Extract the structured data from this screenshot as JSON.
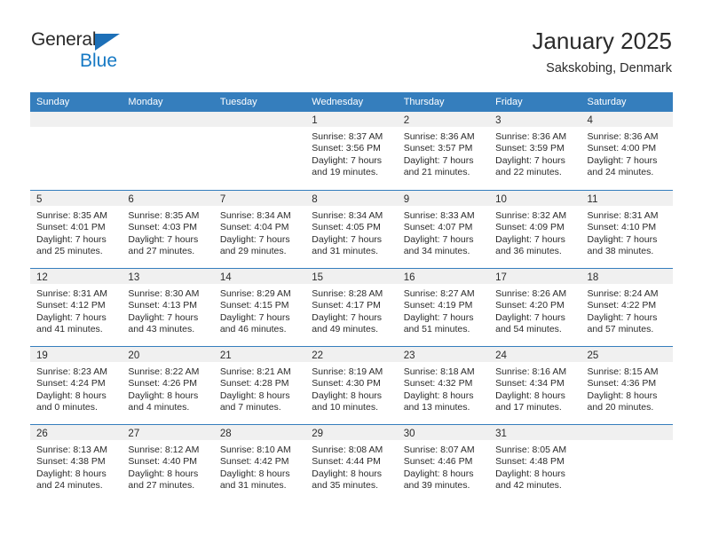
{
  "brand": {
    "name_top": "General",
    "name_bottom": "Blue",
    "accent_color": "#1679c4",
    "triangle_icon": "blue-triangle-icon"
  },
  "header": {
    "title": "January 2025",
    "subtitle": "Sakskobing, Denmark",
    "header_bg_color": "#357ebd",
    "day_band_color": "#f0f0f0"
  },
  "weekdays": [
    "Sunday",
    "Monday",
    "Tuesday",
    "Wednesday",
    "Thursday",
    "Friday",
    "Saturday"
  ],
  "weeks": [
    [
      {
        "day": "",
        "lines": []
      },
      {
        "day": "",
        "lines": []
      },
      {
        "day": "",
        "lines": []
      },
      {
        "day": "1",
        "lines": [
          "Sunrise: 8:37 AM",
          "Sunset: 3:56 PM",
          "Daylight: 7 hours",
          "and 19 minutes."
        ]
      },
      {
        "day": "2",
        "lines": [
          "Sunrise: 8:36 AM",
          "Sunset: 3:57 PM",
          "Daylight: 7 hours",
          "and 21 minutes."
        ]
      },
      {
        "day": "3",
        "lines": [
          "Sunrise: 8:36 AM",
          "Sunset: 3:59 PM",
          "Daylight: 7 hours",
          "and 22 minutes."
        ]
      },
      {
        "day": "4",
        "lines": [
          "Sunrise: 8:36 AM",
          "Sunset: 4:00 PM",
          "Daylight: 7 hours",
          "and 24 minutes."
        ]
      }
    ],
    [
      {
        "day": "5",
        "lines": [
          "Sunrise: 8:35 AM",
          "Sunset: 4:01 PM",
          "Daylight: 7 hours",
          "and 25 minutes."
        ]
      },
      {
        "day": "6",
        "lines": [
          "Sunrise: 8:35 AM",
          "Sunset: 4:03 PM",
          "Daylight: 7 hours",
          "and 27 minutes."
        ]
      },
      {
        "day": "7",
        "lines": [
          "Sunrise: 8:34 AM",
          "Sunset: 4:04 PM",
          "Daylight: 7 hours",
          "and 29 minutes."
        ]
      },
      {
        "day": "8",
        "lines": [
          "Sunrise: 8:34 AM",
          "Sunset: 4:05 PM",
          "Daylight: 7 hours",
          "and 31 minutes."
        ]
      },
      {
        "day": "9",
        "lines": [
          "Sunrise: 8:33 AM",
          "Sunset: 4:07 PM",
          "Daylight: 7 hours",
          "and 34 minutes."
        ]
      },
      {
        "day": "10",
        "lines": [
          "Sunrise: 8:32 AM",
          "Sunset: 4:09 PM",
          "Daylight: 7 hours",
          "and 36 minutes."
        ]
      },
      {
        "day": "11",
        "lines": [
          "Sunrise: 8:31 AM",
          "Sunset: 4:10 PM",
          "Daylight: 7 hours",
          "and 38 minutes."
        ]
      }
    ],
    [
      {
        "day": "12",
        "lines": [
          "Sunrise: 8:31 AM",
          "Sunset: 4:12 PM",
          "Daylight: 7 hours",
          "and 41 minutes."
        ]
      },
      {
        "day": "13",
        "lines": [
          "Sunrise: 8:30 AM",
          "Sunset: 4:13 PM",
          "Daylight: 7 hours",
          "and 43 minutes."
        ]
      },
      {
        "day": "14",
        "lines": [
          "Sunrise: 8:29 AM",
          "Sunset: 4:15 PM",
          "Daylight: 7 hours",
          "and 46 minutes."
        ]
      },
      {
        "day": "15",
        "lines": [
          "Sunrise: 8:28 AM",
          "Sunset: 4:17 PM",
          "Daylight: 7 hours",
          "and 49 minutes."
        ]
      },
      {
        "day": "16",
        "lines": [
          "Sunrise: 8:27 AM",
          "Sunset: 4:19 PM",
          "Daylight: 7 hours",
          "and 51 minutes."
        ]
      },
      {
        "day": "17",
        "lines": [
          "Sunrise: 8:26 AM",
          "Sunset: 4:20 PM",
          "Daylight: 7 hours",
          "and 54 minutes."
        ]
      },
      {
        "day": "18",
        "lines": [
          "Sunrise: 8:24 AM",
          "Sunset: 4:22 PM",
          "Daylight: 7 hours",
          "and 57 minutes."
        ]
      }
    ],
    [
      {
        "day": "19",
        "lines": [
          "Sunrise: 8:23 AM",
          "Sunset: 4:24 PM",
          "Daylight: 8 hours",
          "and 0 minutes."
        ]
      },
      {
        "day": "20",
        "lines": [
          "Sunrise: 8:22 AM",
          "Sunset: 4:26 PM",
          "Daylight: 8 hours",
          "and 4 minutes."
        ]
      },
      {
        "day": "21",
        "lines": [
          "Sunrise: 8:21 AM",
          "Sunset: 4:28 PM",
          "Daylight: 8 hours",
          "and 7 minutes."
        ]
      },
      {
        "day": "22",
        "lines": [
          "Sunrise: 8:19 AM",
          "Sunset: 4:30 PM",
          "Daylight: 8 hours",
          "and 10 minutes."
        ]
      },
      {
        "day": "23",
        "lines": [
          "Sunrise: 8:18 AM",
          "Sunset: 4:32 PM",
          "Daylight: 8 hours",
          "and 13 minutes."
        ]
      },
      {
        "day": "24",
        "lines": [
          "Sunrise: 8:16 AM",
          "Sunset: 4:34 PM",
          "Daylight: 8 hours",
          "and 17 minutes."
        ]
      },
      {
        "day": "25",
        "lines": [
          "Sunrise: 8:15 AM",
          "Sunset: 4:36 PM",
          "Daylight: 8 hours",
          "and 20 minutes."
        ]
      }
    ],
    [
      {
        "day": "26",
        "lines": [
          "Sunrise: 8:13 AM",
          "Sunset: 4:38 PM",
          "Daylight: 8 hours",
          "and 24 minutes."
        ]
      },
      {
        "day": "27",
        "lines": [
          "Sunrise: 8:12 AM",
          "Sunset: 4:40 PM",
          "Daylight: 8 hours",
          "and 27 minutes."
        ]
      },
      {
        "day": "28",
        "lines": [
          "Sunrise: 8:10 AM",
          "Sunset: 4:42 PM",
          "Daylight: 8 hours",
          "and 31 minutes."
        ]
      },
      {
        "day": "29",
        "lines": [
          "Sunrise: 8:08 AM",
          "Sunset: 4:44 PM",
          "Daylight: 8 hours",
          "and 35 minutes."
        ]
      },
      {
        "day": "30",
        "lines": [
          "Sunrise: 8:07 AM",
          "Sunset: 4:46 PM",
          "Daylight: 8 hours",
          "and 39 minutes."
        ]
      },
      {
        "day": "31",
        "lines": [
          "Sunrise: 8:05 AM",
          "Sunset: 4:48 PM",
          "Daylight: 8 hours",
          "and 42 minutes."
        ]
      },
      {
        "day": "",
        "lines": []
      }
    ]
  ]
}
